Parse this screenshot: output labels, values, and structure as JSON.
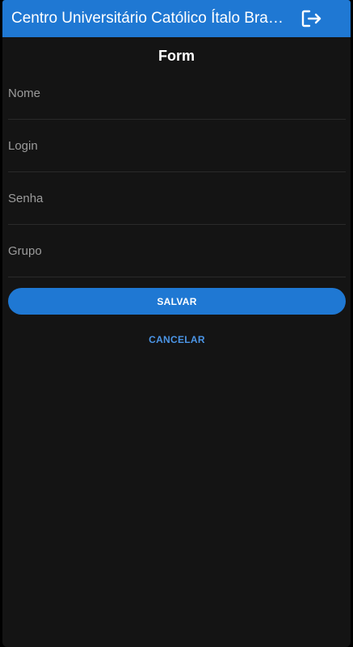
{
  "appbar": {
    "title": "Centro Universitário Católico Ítalo Brasileiro",
    "logout_icon": "logout-icon",
    "color": "#1f78d3"
  },
  "form": {
    "title": "Form",
    "fields": [
      {
        "placeholder": "Nome",
        "value": ""
      },
      {
        "placeholder": "Login",
        "value": ""
      },
      {
        "placeholder": "Senha",
        "value": ""
      },
      {
        "placeholder": "Grupo",
        "value": ""
      }
    ],
    "save_label": "SALVAR",
    "cancel_label": "CANCELAR"
  },
  "colors": {
    "background": "#141414",
    "accent": "#1f78d3",
    "link": "#4b95e6"
  }
}
